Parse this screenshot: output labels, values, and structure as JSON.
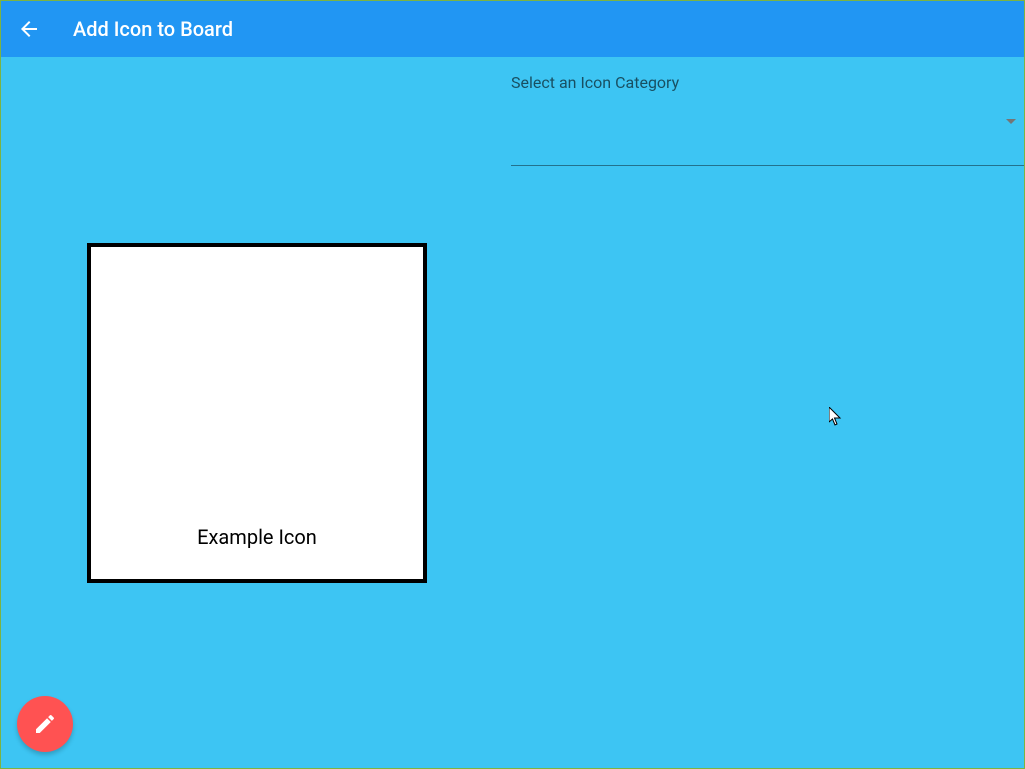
{
  "header": {
    "title": "Add Icon to Board"
  },
  "preview": {
    "label": "Example Icon"
  },
  "category": {
    "label": "Select an Icon Category",
    "selected": ""
  }
}
